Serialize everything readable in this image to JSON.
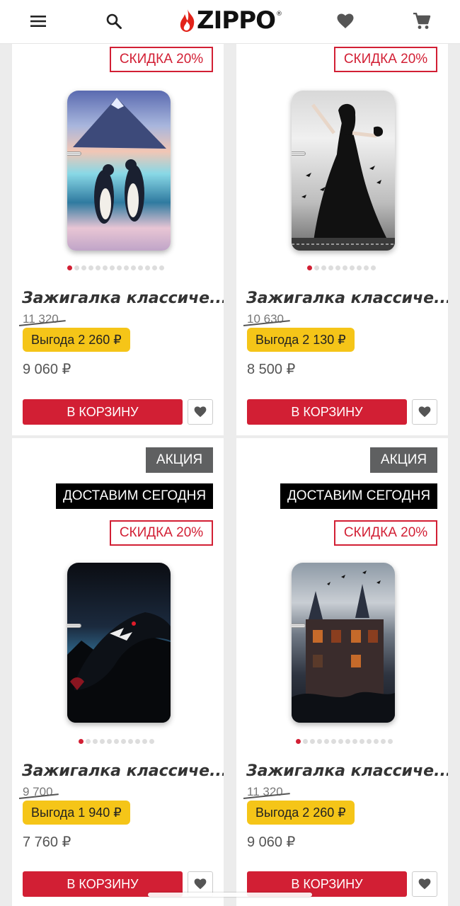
{
  "header": {
    "menu_icon": "hamburger-menu-icon",
    "search_icon": "search-icon",
    "logo_text": "ZIPPO",
    "logo_reg": "®",
    "favorites_icon": "heart-icon",
    "cart_icon": "shopping-cart-icon"
  },
  "colors": {
    "brand_red": "#d21f34",
    "benefit_yellow": "#f5c518",
    "promo_grey": "#5f6061"
  },
  "products": [
    {
      "badges": {
        "discount": "СКИДКА 20%"
      },
      "title": "Зажигалка классиче...",
      "old_price": "11 320",
      "benefit": "Выгода 2 260 ₽",
      "price": "9 060 ₽",
      "cart_label": "В КОРЗИНУ",
      "image_dots": 14,
      "image_active": 0
    },
    {
      "badges": {
        "discount": "СКИДКА 20%"
      },
      "title": "Зажигалка классиче...",
      "old_price": "10 630",
      "benefit": "Выгода 2 130 ₽",
      "price": "8 500 ₽",
      "cart_label": "В КОРЗИНУ",
      "image_dots": 10,
      "image_active": 0
    },
    {
      "badges": {
        "promo": "АКЦИЯ",
        "delivery": "ДОСТАВИМ СЕГОДНЯ",
        "discount": "СКИДКА 20%"
      },
      "title": "Зажигалка классиче...",
      "old_price": "9 700",
      "benefit": "Выгода 1 940 ₽",
      "price": "7 760 ₽",
      "cart_label": "В КОРЗИНУ",
      "image_dots": 11,
      "image_active": 0
    },
    {
      "badges": {
        "promo": "АКЦИЯ",
        "delivery": "ДОСТАВИМ СЕГОДНЯ",
        "discount": "СКИДКА 20%"
      },
      "title": "Зажигалка классиче...",
      "old_price": "11 320",
      "benefit": "Выгода 2 260 ₽",
      "price": "9 060 ₽",
      "cart_label": "В КОРЗИНУ",
      "image_dots": 14,
      "image_active": 0
    }
  ]
}
